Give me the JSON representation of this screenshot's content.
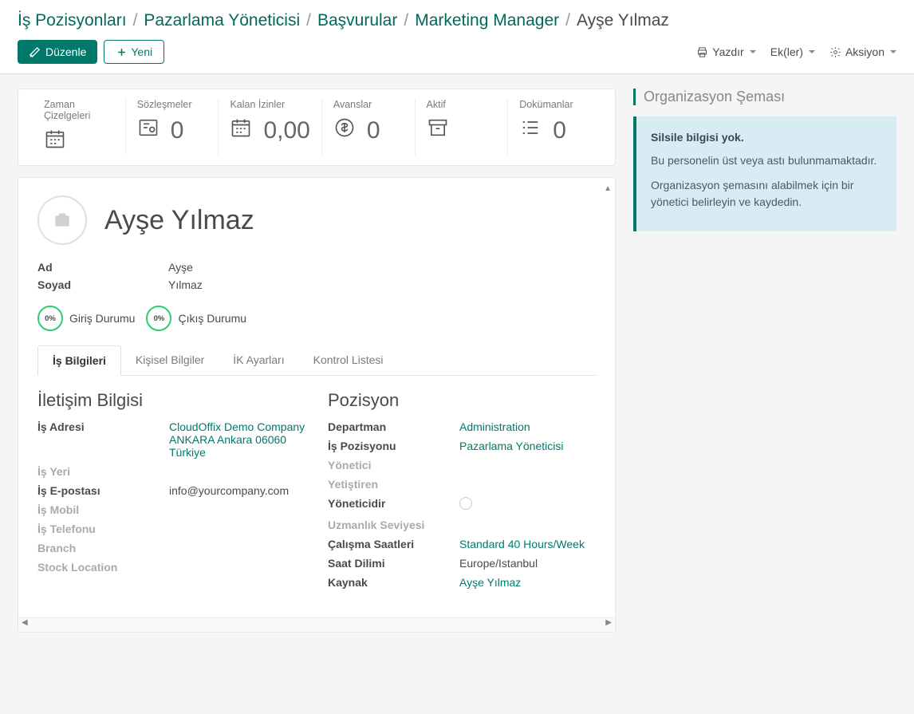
{
  "breadcrumb": [
    {
      "label": "İş Pozisyonları"
    },
    {
      "label": "Pazarlama Yöneticisi"
    },
    {
      "label": "Başvurular"
    },
    {
      "label": "Marketing Manager"
    },
    {
      "label": "Ayşe Yılmaz"
    }
  ],
  "toolbar": {
    "edit": "Düzenle",
    "new": "Yeni",
    "print": "Yazdır",
    "attachments": "Ek(ler)",
    "action": "Aksiyon"
  },
  "stats": [
    {
      "label": "Zaman Çizelgeleri",
      "value": "",
      "icon": "calendar"
    },
    {
      "label": "Sözleşmeler",
      "value": "0",
      "icon": "contract"
    },
    {
      "label": "Kalan İzinler",
      "value": "0,00",
      "icon": "calendar"
    },
    {
      "label": "Avanslar",
      "value": "0",
      "icon": "currency"
    },
    {
      "label": "Aktif",
      "value": "",
      "icon": "archive"
    },
    {
      "label": "Dokümanlar",
      "value": "0",
      "icon": "list"
    }
  ],
  "person": {
    "full_name": "Ayşe Yılmaz",
    "first_label": "Ad",
    "first": "Ayşe",
    "last_label": "Soyad",
    "last": "Yılmaz"
  },
  "status": {
    "in_pct": "0%",
    "in_label": "Giriş Durumu",
    "out_pct": "0%",
    "out_label": "Çıkış Durumu"
  },
  "tabs": [
    "İş Bilgileri",
    "Kişisel Bilgiler",
    "İK Ayarları",
    "Kontrol Listesi"
  ],
  "contact": {
    "title": "İletişim Bilgisi",
    "address_label": "İş Adresi",
    "address_line1": "CloudOffix Demo Company",
    "address_line2": "ANKARA Ankara 06060",
    "address_line3": "Türkiye",
    "workplace_label": "İş Yeri",
    "email_label": "İş E-postası",
    "email": "info@yourcompany.com",
    "mobile_label": "İş Mobil",
    "phone_label": "İş Telefonu",
    "branch_label": "Branch",
    "stock_label": "Stock Location"
  },
  "position": {
    "title": "Pozisyon",
    "dept_label": "Departman",
    "dept": "Administration",
    "jobpos_label": "İş Pozisyonu",
    "jobpos": "Pazarlama Yöneticisi",
    "manager_label": "Yönetici",
    "coach_label": "Yetiştiren",
    "ismanager_label": "Yöneticidir",
    "seniority_label": "Uzmanlık Seviyesi",
    "hours_label": "Çalışma Saatleri",
    "hours": "Standard 40 Hours/Week",
    "tz_label": "Saat Dilimi",
    "tz": "Europe/Istanbul",
    "resource_label": "Kaynak",
    "resource": "Ayşe Yılmaz"
  },
  "side": {
    "title": "Organizasyon Şeması",
    "box_title": "Silsile bilgisi yok.",
    "box_p1": "Bu personelin üst veya astı bulunmamaktadır.",
    "box_p2": "Organizasyon şemasını alabilmek için bir yönetici belirleyin ve kaydedin."
  }
}
